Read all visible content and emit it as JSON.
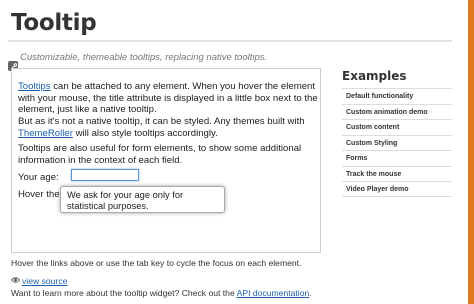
{
  "page": {
    "title": "Tooltip",
    "subtitle": "Customizable, themeable tooltips, replacing native tooltips."
  },
  "demo": {
    "p1_link": "Tooltips",
    "p1_text": " can be attached to any element. When you hover the element with your mouse, the title attribute is displayed in a little box next to the element, just like a native tooltip.",
    "p2_text": "But as it's not a native tooltip, it can be styled. Any themes built with ",
    "p2_link": "ThemeRoller",
    "p2_text2": " will also style tooltips accordingly.",
    "p3_text": "Tooltips are also useful for form elements, to show some additional information in the context of each field.",
    "age_label": "Your age:",
    "age_value": "",
    "hover_label": "Hover the field to see the tooltip.",
    "tooltip_text": "We ask for your age only for statistical purposes."
  },
  "footer": {
    "hint": "Hover the links above or use the tab key to cycle the focus on each element.",
    "view_source": "view source",
    "learn_more": "Want to learn more about the tooltip widget? Check out the ",
    "api_link": "API documentation",
    "learn_more_end": "."
  },
  "sidebar": {
    "title": "Examples",
    "items": [
      {
        "label": "Default functionality"
      },
      {
        "label": "Custom animation demo"
      },
      {
        "label": "Custom content"
      },
      {
        "label": "Custom Styling"
      },
      {
        "label": "Forms"
      },
      {
        "label": "Track the mouse"
      },
      {
        "label": "Video Player demo"
      }
    ]
  },
  "icons": {
    "wrench": "wrench-icon",
    "eye": "eye-icon"
  },
  "colors": {
    "accent": "#e07a1f",
    "link": "#1b5fae",
    "focus": "#5b93d3"
  }
}
